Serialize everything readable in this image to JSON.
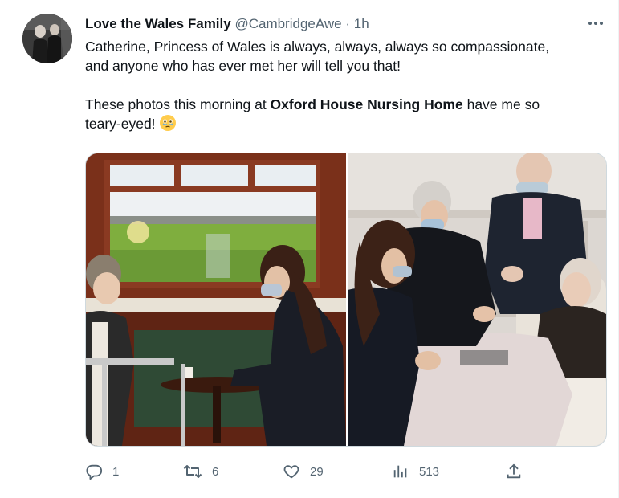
{
  "tweet": {
    "display_name": "Love the Wales Family",
    "handle": "@CambridgeAwe",
    "separator": "·",
    "time": "1h",
    "text_line1": "Catherine, Princess of Wales is always, always, always so compassionate,",
    "text_line2": "and anyone who has ever met her will tell you that!",
    "text_p2_before": "These photos this morning at ",
    "text_p2_bold": "Oxford House Nursing Home",
    "text_p2_after": " have me so",
    "text_p2_line2": "teary-eyed!",
    "emoji": "face-holding-back-tears-emoji"
  },
  "media": {
    "count": 2
  },
  "actions": {
    "reply_count": "1",
    "retweet_count": "6",
    "like_count": "29",
    "views_count": "513"
  },
  "icons": {
    "more": "more-dots-icon",
    "reply": "reply-bubble-icon",
    "retweet": "retweet-icon",
    "like": "heart-icon",
    "views": "views-bar-chart-icon",
    "share": "share-upload-icon"
  },
  "colors": {
    "text": "#0f1419",
    "secondary": "#536471",
    "border": "#cfd9de"
  }
}
